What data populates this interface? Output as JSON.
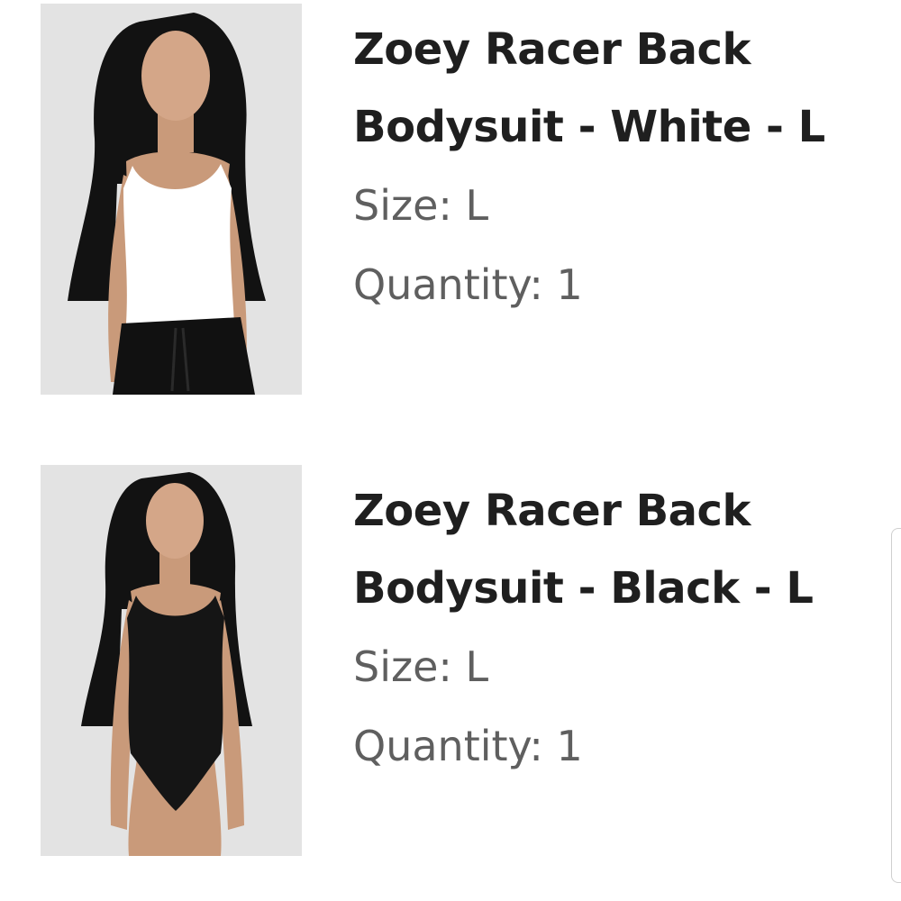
{
  "orders": {
    "items": [
      {
        "title_line1": "Zoey Racer Back",
        "title_line2": "Bodysuit - White - L",
        "size": "Size: L",
        "quantity": "Quantity: 1",
        "image": {
          "icon": "product-photo-white-bodysuit",
          "garment_color": "#ffffff",
          "bottoms_color": "#111111",
          "background_color": "#e3e3e3"
        }
      },
      {
        "title_line1": "Zoey Racer Back",
        "title_line2": "Bodysuit - Black - L",
        "size": "Size: L",
        "quantity": "Quantity: 1",
        "image": {
          "icon": "product-photo-black-bodysuit",
          "garment_color": "#151515",
          "background_color": "#e3e3e3"
        }
      }
    ]
  },
  "colors": {
    "title": "#1f1f1f",
    "meta": "#5f5f5f",
    "page_background": "#ffffff"
  }
}
